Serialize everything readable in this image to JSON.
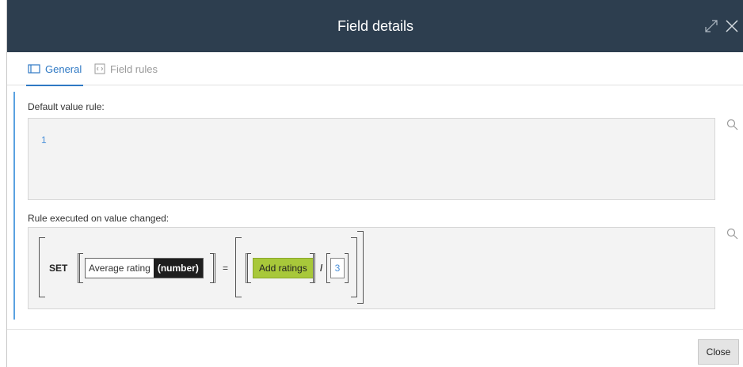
{
  "dialog": {
    "title": "Field details"
  },
  "tabs": [
    {
      "label": "General",
      "icon": "card-icon",
      "active": true
    },
    {
      "label": "Field rules",
      "icon": "code-icon",
      "active": false
    }
  ],
  "default_rule": {
    "label": "Default value rule:",
    "value": "1"
  },
  "change_rule": {
    "label": "Rule executed on value changed:",
    "keyword": "SET",
    "target_field": "Average rating",
    "target_type": "(number)",
    "equals": "=",
    "source_field": "Add ratings",
    "divide": "/",
    "divisor": "3"
  },
  "footer": {
    "close_label": "Close"
  },
  "colors": {
    "header_bg": "#2d3e4f",
    "accent": "#2f79c4",
    "highlight_chip": "#a8c83a",
    "number_text": "#4a90d9"
  }
}
